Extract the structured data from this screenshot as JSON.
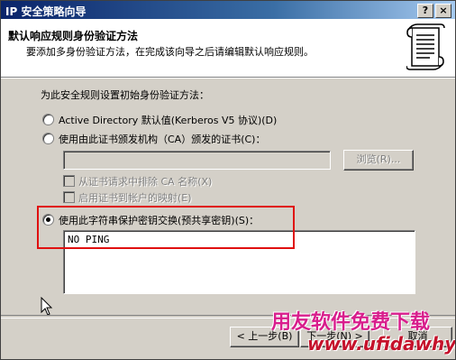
{
  "window": {
    "title": "IP 安全策略向导",
    "help_button": "?",
    "close_button": "×"
  },
  "header": {
    "title": "默认响应规则身份验证方法",
    "subtitle": "要添加多身份验证方法，在完成该向导之后请编辑默认响应规则。",
    "icon": "scroll-icon"
  },
  "main": {
    "prompt": "为此安全规则设置初始身份验证方法：",
    "options": [
      {
        "label": "Active Directory 默认值(Kerberos V5 协议)(D)",
        "checked": false
      },
      {
        "label": "使用由此证书颁发机构（CA）颁发的证书(C)：",
        "checked": false
      },
      {
        "label": "使用此字符串保护密钥交换(预共享密钥)(S)：",
        "checked": true
      }
    ],
    "browse_button": "浏览(R)...",
    "checkboxes": [
      {
        "label": "从证书请求中排除 CA 名称(X)",
        "checked": false,
        "disabled": true
      },
      {
        "label": "启用证书到帐户的映射(E)",
        "checked": false,
        "disabled": true
      }
    ],
    "preshared_key_value": "NO PING"
  },
  "footer": {
    "back_button": "< 上一步(B)",
    "next_button": "下一步(N) >",
    "cancel_button": "取消"
  },
  "watermark": {
    "line1": "用友软件免费下载",
    "line2": "www.ufidawhy.com"
  },
  "colors": {
    "titlebar_start": "#0a246a",
    "dialog_face": "#d4d0c8",
    "highlight_border": "#e01010",
    "watermark_pink": "#d81e8c",
    "watermark_red": "#c5122b"
  }
}
